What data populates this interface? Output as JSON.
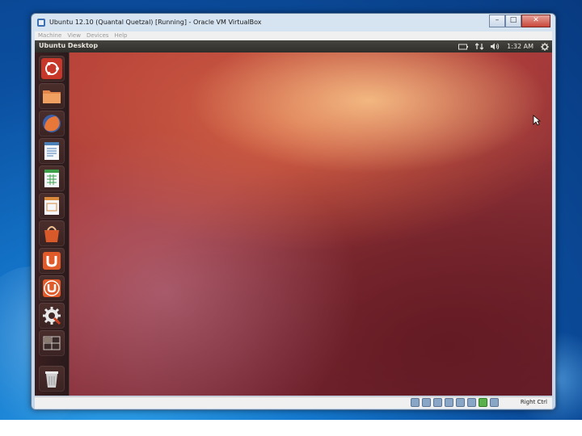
{
  "window": {
    "title": "Ubuntu 12.10 (Quantal Quetzal) [Running] - Oracle VM VirtualBox",
    "caption_buttons": [
      "minimize-icon",
      "maximize-icon",
      "close-icon"
    ]
  },
  "menu": {
    "items": [
      "Machine",
      "View",
      "Devices",
      "Help"
    ]
  },
  "unity_panel": {
    "title": "Ubuntu Desktop",
    "indicators": [
      {
        "icon": "battery-icon",
        "label": ""
      },
      {
        "icon": "network-icon",
        "label": ""
      },
      {
        "icon": "volume-icon",
        "label": ""
      },
      {
        "icon": "clock",
        "label": "1:32 AM"
      },
      {
        "icon": "gear-icon",
        "label": ""
      }
    ]
  },
  "launcher": {
    "items": [
      {
        "name": "dash-home-icon",
        "color": "#e06a30"
      },
      {
        "name": "files-icon",
        "color": "#e2864a"
      },
      {
        "name": "firefox-icon",
        "color": "#e8783a"
      },
      {
        "name": "libreoffice-writer-icon",
        "color": "#4a7fb8"
      },
      {
        "name": "libreoffice-calc-icon",
        "color": "#3fa04a"
      },
      {
        "name": "libreoffice-impress-icon",
        "color": "#d88a3a"
      },
      {
        "name": "software-center-icon",
        "color": "#d85a2a"
      },
      {
        "name": "ubuntu-one-icon",
        "color": "#e05a2a"
      },
      {
        "name": "ubuntu-one-music-icon",
        "color": "#e05a2a"
      },
      {
        "name": "system-settings-icon",
        "color": "#c84020"
      },
      {
        "name": "workspace-switcher-icon",
        "color": "#6a4a4a"
      },
      {
        "name": "trash-icon",
        "color": "#cfcfcf"
      }
    ]
  },
  "statusbar": {
    "host_key": "Right Ctrl"
  }
}
